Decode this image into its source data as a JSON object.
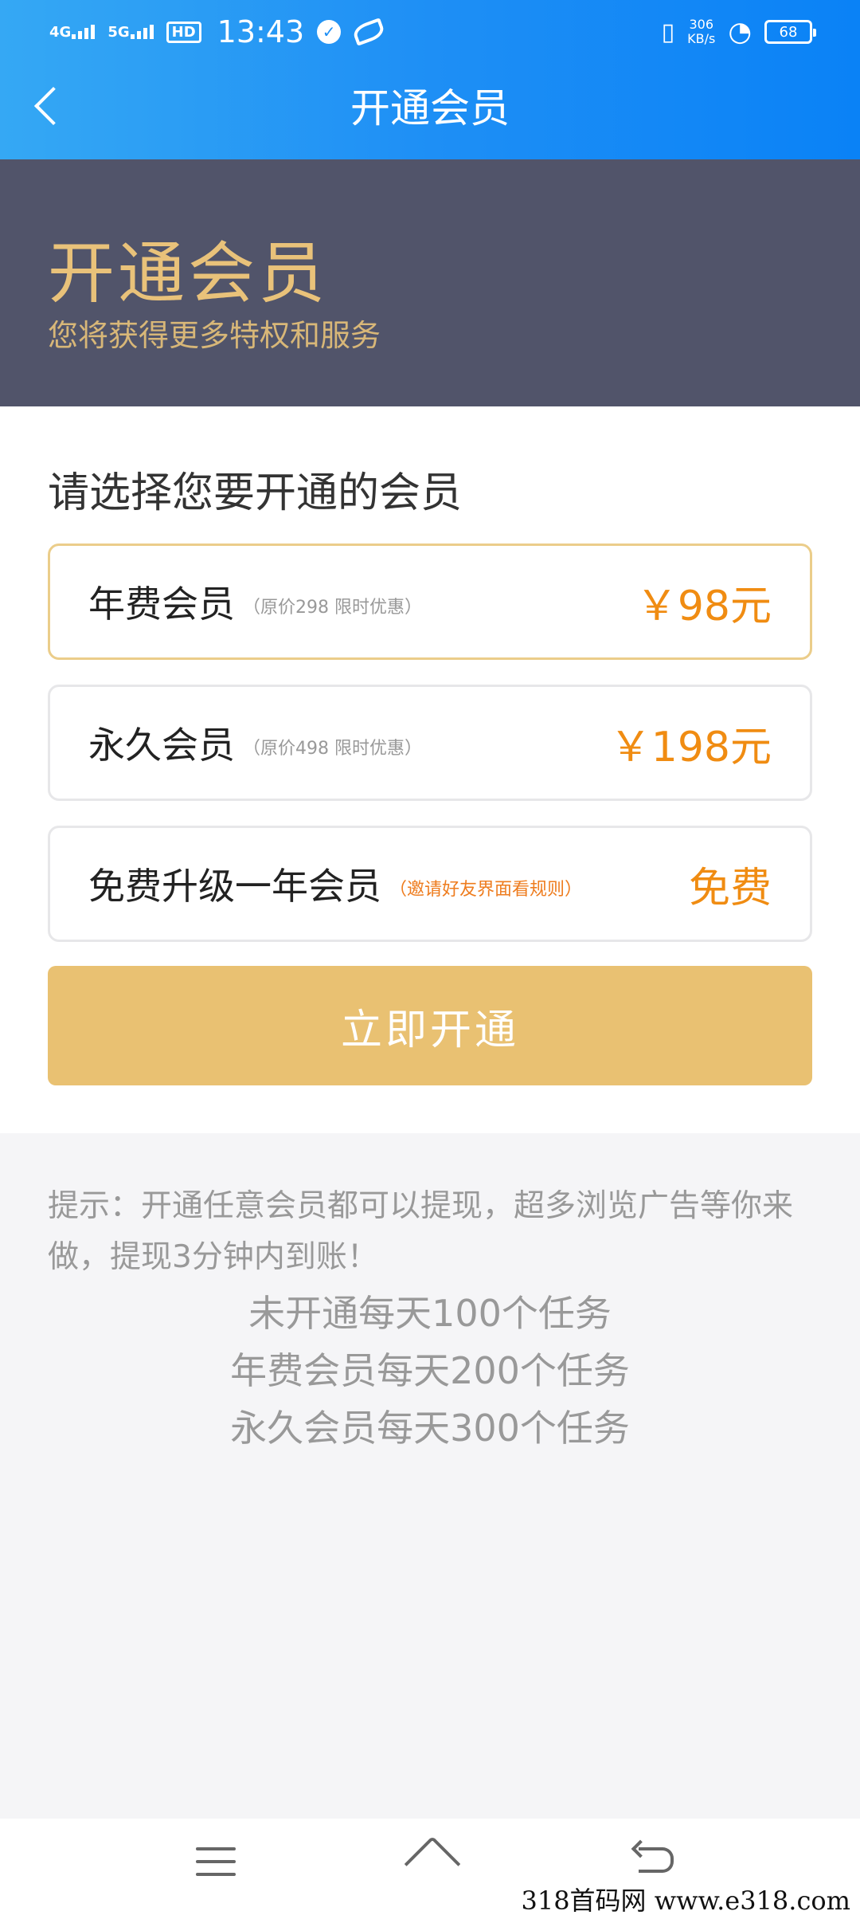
{
  "status_bar": {
    "signal_1": "4G",
    "signal_2": "5G",
    "hd": "HD",
    "time": "13:43",
    "net_speed": "306",
    "net_unit": "KB/s",
    "battery": "68"
  },
  "header": {
    "title": "开通会员"
  },
  "banner": {
    "title": "开通会员",
    "subtitle": "您将获得更多特权和服务"
  },
  "select": {
    "title": "请选择您要开通的会员",
    "options": [
      {
        "name": "年费会员",
        "note": "（原价298 限时优惠）",
        "price": "￥98元"
      },
      {
        "name": "永久会员",
        "note": "（原价498 限时优惠）",
        "price": "￥198元"
      },
      {
        "name": "免费升级一年会员",
        "note": "（邀请好友界面看规则）",
        "price": "免费"
      }
    ],
    "cta": "立即开通"
  },
  "tips": {
    "text": "提示：开通任意会员都可以提现，超多浏览广告等你来做，提现3分钟内到账！",
    "lines": [
      "未开通每天100个任务",
      "年费会员每天200个任务",
      "永久会员每天300个任务"
    ]
  },
  "watermark": "318首码网  www.e318.com",
  "colors": {
    "header_blue": "#1e8ff5",
    "banner_bg": "#51546a",
    "gold": "#e9c27a",
    "price_orange": "#f08c12",
    "cta_gold": "#e9c172"
  },
  "icons": {
    "back": "chevron-left-icon",
    "menu": "menu-icon",
    "home": "home-icon",
    "return": "return-icon"
  }
}
